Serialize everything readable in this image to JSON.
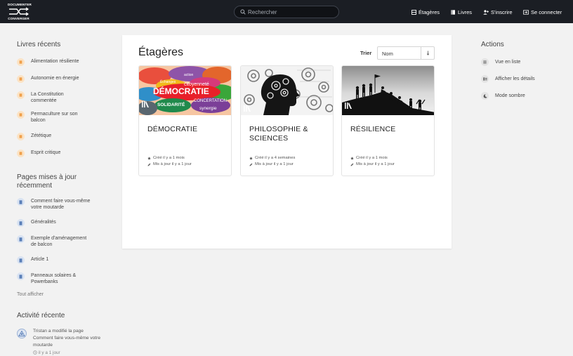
{
  "header": {
    "logo_line1": "DOCUMENTER",
    "logo_line2": "CONVERGER",
    "search_placeholder": "Rechercher",
    "nav": {
      "shelves": "Étagères",
      "books": "Livres",
      "register": "S'inscrire",
      "login": "Se connecter"
    }
  },
  "sidebar": {
    "recent_books_title": "Livres récents",
    "recent_books": [
      "Alimentation résiliente",
      "Autonomie en énergie",
      "La Constitution commentée",
      "Permaculture sur son balcon",
      "Zététique",
      "Esprit critique"
    ],
    "updated_pages_title": "Pages mises à jour récemment",
    "updated_pages": [
      "Comment faire vous-même votre moutarde",
      "Généralités",
      "Exemple d'aménagement de balcon",
      "Article 1",
      "Panneaux solaires & Powerbanks"
    ],
    "view_all": "Tout afficher",
    "activity_title": "Activité récente",
    "activity": {
      "text": "Tristan a modifié la page Comment faire vous-même votre moutarde",
      "time": "il y a 1 jour"
    }
  },
  "main": {
    "title": "Étagères",
    "sort_label": "Trier",
    "sort_value": "Nom",
    "shelves": [
      {
        "name": "DÉMOCRATIE",
        "created": "Créé il y a 1 mois",
        "updated": "Mis à jour il y a 1 jour"
      },
      {
        "name": "PHILOSOPHIE & SCIENCES",
        "created": "Créé il y a 4 semaines",
        "updated": "Mis à jour il y a 1 jour"
      },
      {
        "name": "RÉSILIENCE",
        "created": "Créé il y a 1 mois",
        "updated": "Mis à jour il y a 1 jour"
      }
    ],
    "cover_words": {
      "democratie": "DÉMOCRATIE",
      "citoyennete": "citoyenneté",
      "solidarite": "SOLIDARITÉ",
      "concertation": "CONCERTATION",
      "synergie": "synergie",
      "echanges": "Échanges",
      "action": "action"
    }
  },
  "actions": {
    "title": "Actions",
    "items": [
      "Vue en liste",
      "Afficher les détails",
      "Mode sombre"
    ]
  },
  "colors": {
    "header_bg": "#1b1e24",
    "book_icon": "#f0a04b",
    "page_icon": "#5a7fb8"
  }
}
